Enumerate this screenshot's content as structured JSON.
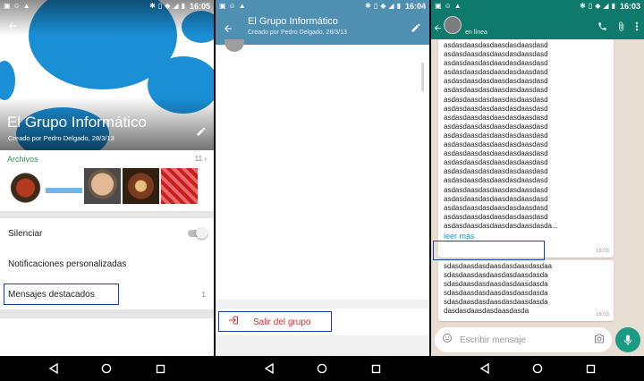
{
  "status_times": [
    "16:05",
    "16:04",
    "16:03"
  ],
  "screen1": {
    "title": "El Grupo Informático",
    "subtitle": "Creado por Pedro Delgado, 28/3/13",
    "media_label": "Archivos",
    "media_count": "11",
    "rows": {
      "mute": "Silenciar",
      "custom_notifications": "Notificaciones personalizadas",
      "starred": "Mensajes destacados",
      "starred_count": "1"
    }
  },
  "screen2": {
    "title": "El Grupo Informático",
    "subtitle": "Creado por Pedro Delgado, 28/3/13",
    "exit_label": "Salir del grupo"
  },
  "screen3": {
    "status": "en línea",
    "message1_lines": [
      "asdasdaasdasdaasdasdaasdasd",
      "asdasdaasdasdaasdasdaasdasd",
      "asdasdaasdasdaasdasdaasdasd",
      "asdasdaasdasdaasdasdaasdasd",
      "asdasdaasdasdaasdasdaasdasd",
      "asdasdaasdasdaasdasdaasdasd",
      "asdasdaasdasdaasdasdaasdasd",
      "asdasdaasdasdaasdasdaasdasd",
      "asdasdaasdasdaasdasdaasdasd",
      "asdasdaasdasdaasdasdaasdasd",
      "asdasdaasdasdaasdasdaasdasd",
      "asdasdaasdasdaasdasdaasdasd",
      "asdasdaasdasdaasdasdaasdasd",
      "asdasdaasdasdaasdasdaasdasd",
      "asdasdaasdasdaasdasdaasdasd",
      "asdasdaasdasdaasdasdaasdasd",
      "asdasdaasdasdaasdasdaasdasd",
      "asdasdaasdasdaasdasdaasdasd",
      "asdasdaasdasdaasdasdaasdasd",
      "asdasdaasdasdaasdasdaasdasd",
      "asdasdaasdasdaasdasdaasdasda..."
    ],
    "read_more": "leer más",
    "message1_time": "16:03",
    "message2_lines": [
      "sdasdaasdasdaasdasdaasdasdaa",
      "sdasdaasdasdaasdasdaasdasda",
      "sdasdaasdasdaasdasdaasdasda",
      "sdasdaasdasdaasdasdaasdasda",
      "sdasdaasdasdaasdasdaasdasda",
      "dasdasdaasdasdaasdasda"
    ],
    "message2_time": "16:03",
    "input_placeholder": "Escribir mensaje"
  },
  "colors": {
    "accent_green": "#33925f",
    "toolbar_blue": "#4f8fb1",
    "whatsapp_teal": "#0d7a6b",
    "danger_red": "#d32f2f",
    "highlight_box": "#1a3fa8"
  }
}
